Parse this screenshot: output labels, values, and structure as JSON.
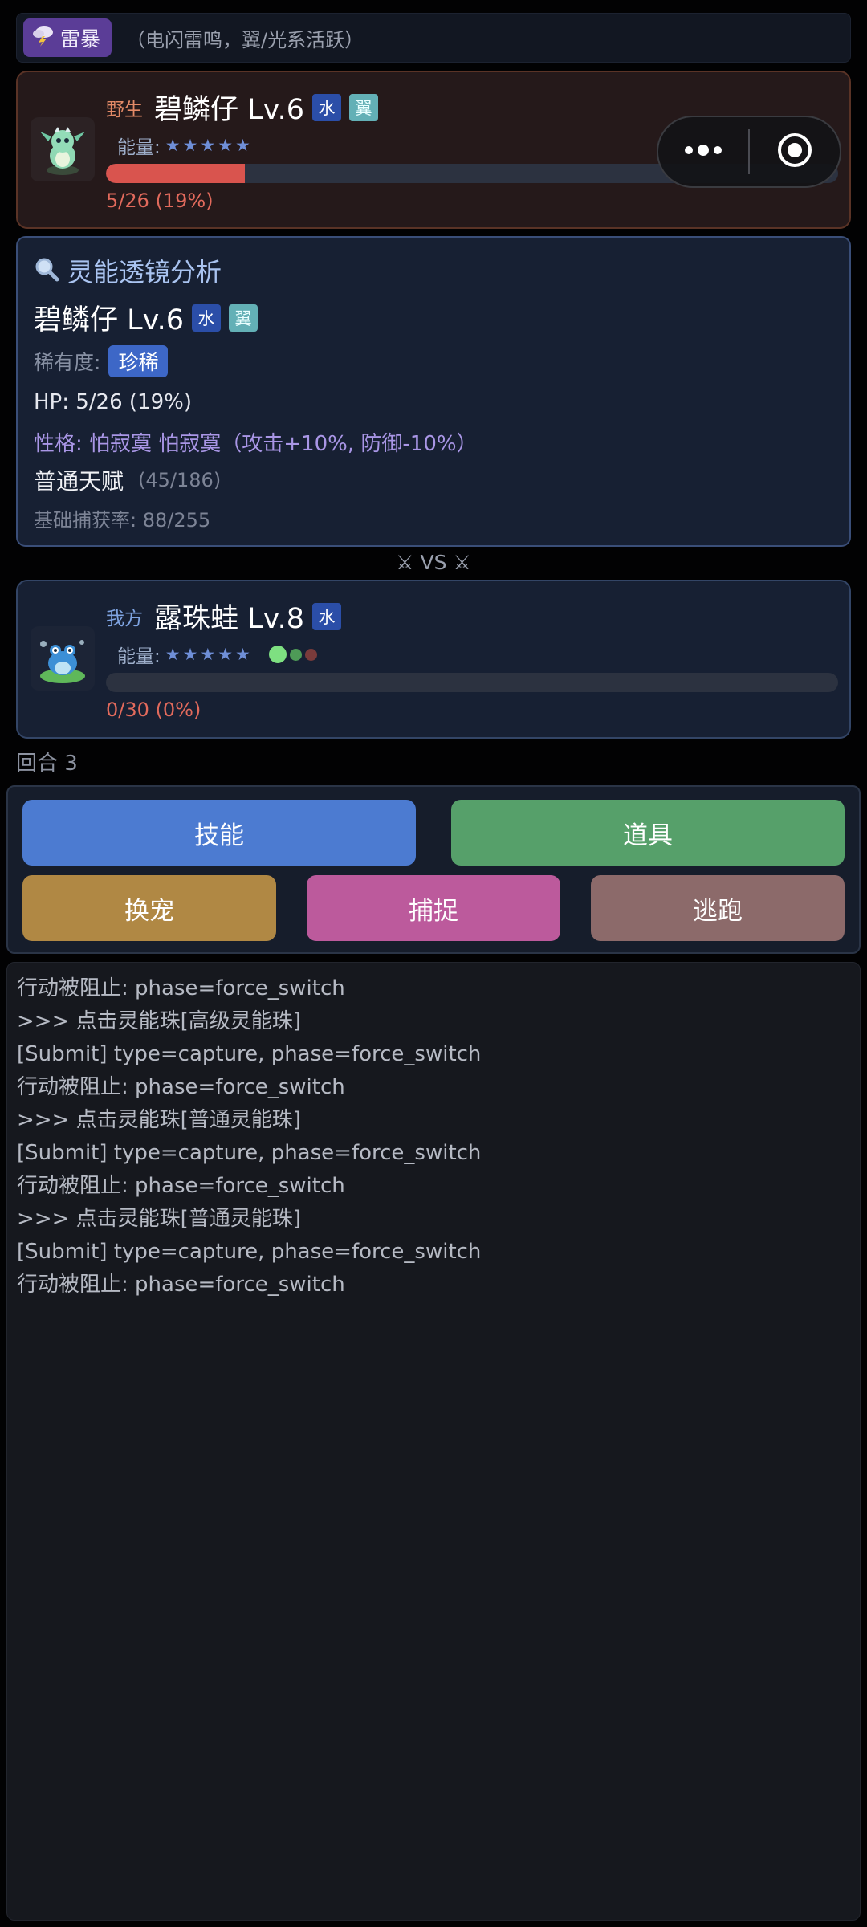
{
  "weather": {
    "icon": "thunderstorm-icon",
    "label": "雷暴",
    "description": "（电闪雷鸣，翼/光系活跃）"
  },
  "enemy": {
    "side": "野生",
    "name": "碧鳞仔 Lv.6",
    "types": [
      "水",
      "翼"
    ],
    "energy_label": "能量:",
    "stars": "★★★★★",
    "hp_text": "5/26 (19%)",
    "hp_fraction": 0.19
  },
  "analysis": {
    "title": "灵能透镜分析",
    "name": "碧鳞仔 Lv.6",
    "types": [
      "水",
      "翼"
    ],
    "rarity_label": "稀有度:",
    "rarity_value": "珍稀",
    "hp": "HP: 5/26 (19%)",
    "nature": "性格: 怕寂寞 怕寂寞（攻击+10%, 防御-10%）",
    "talent": "普通天赋",
    "talent_detail": "(45/186)",
    "capture_rate": "基础捕获率: 88/255"
  },
  "vs_text": "⚔ VS ⚔",
  "ally": {
    "side": "我方",
    "name": "露珠蛙 Lv.8",
    "types": [
      "水"
    ],
    "energy_label": "能量:",
    "stars": "★★★★★",
    "hp_text": "0/30 (0%)",
    "hp_fraction": 0.0,
    "orb_colors": [
      "#7ee081",
      "#4e9a57",
      "#7a3b3b"
    ]
  },
  "round_text": "回合 3",
  "actions": {
    "skill": "技能",
    "item": "道具",
    "switch": "换宠",
    "capture": "捕捉",
    "flee": "逃跑"
  },
  "log": [
    "行动被阻止: phase=force_switch",
    ">>> 点击灵能珠[高级灵能珠]",
    "[Submit] type=capture, phase=force_switch",
    "行动被阻止: phase=force_switch",
    ">>> 点击灵能珠[普通灵能珠]",
    "[Submit] type=capture, phase=force_switch",
    "行动被阻止: phase=force_switch",
    ">>> 点击灵能珠[普通灵能珠]",
    "[Submit] type=capture, phase=force_switch",
    "行动被阻止: phase=force_switch"
  ],
  "capsule": {
    "more_icon": "more-dots-icon",
    "close_icon": "target-circle-icon"
  },
  "colors": {
    "hp_fill": "#d9544e",
    "hp_text": "#e26a5c",
    "skill": "#4c7bd1",
    "item": "#56a06a",
    "switch": "#b08844",
    "capture": "#bc5a9c",
    "flee": "#8c6a6a"
  }
}
